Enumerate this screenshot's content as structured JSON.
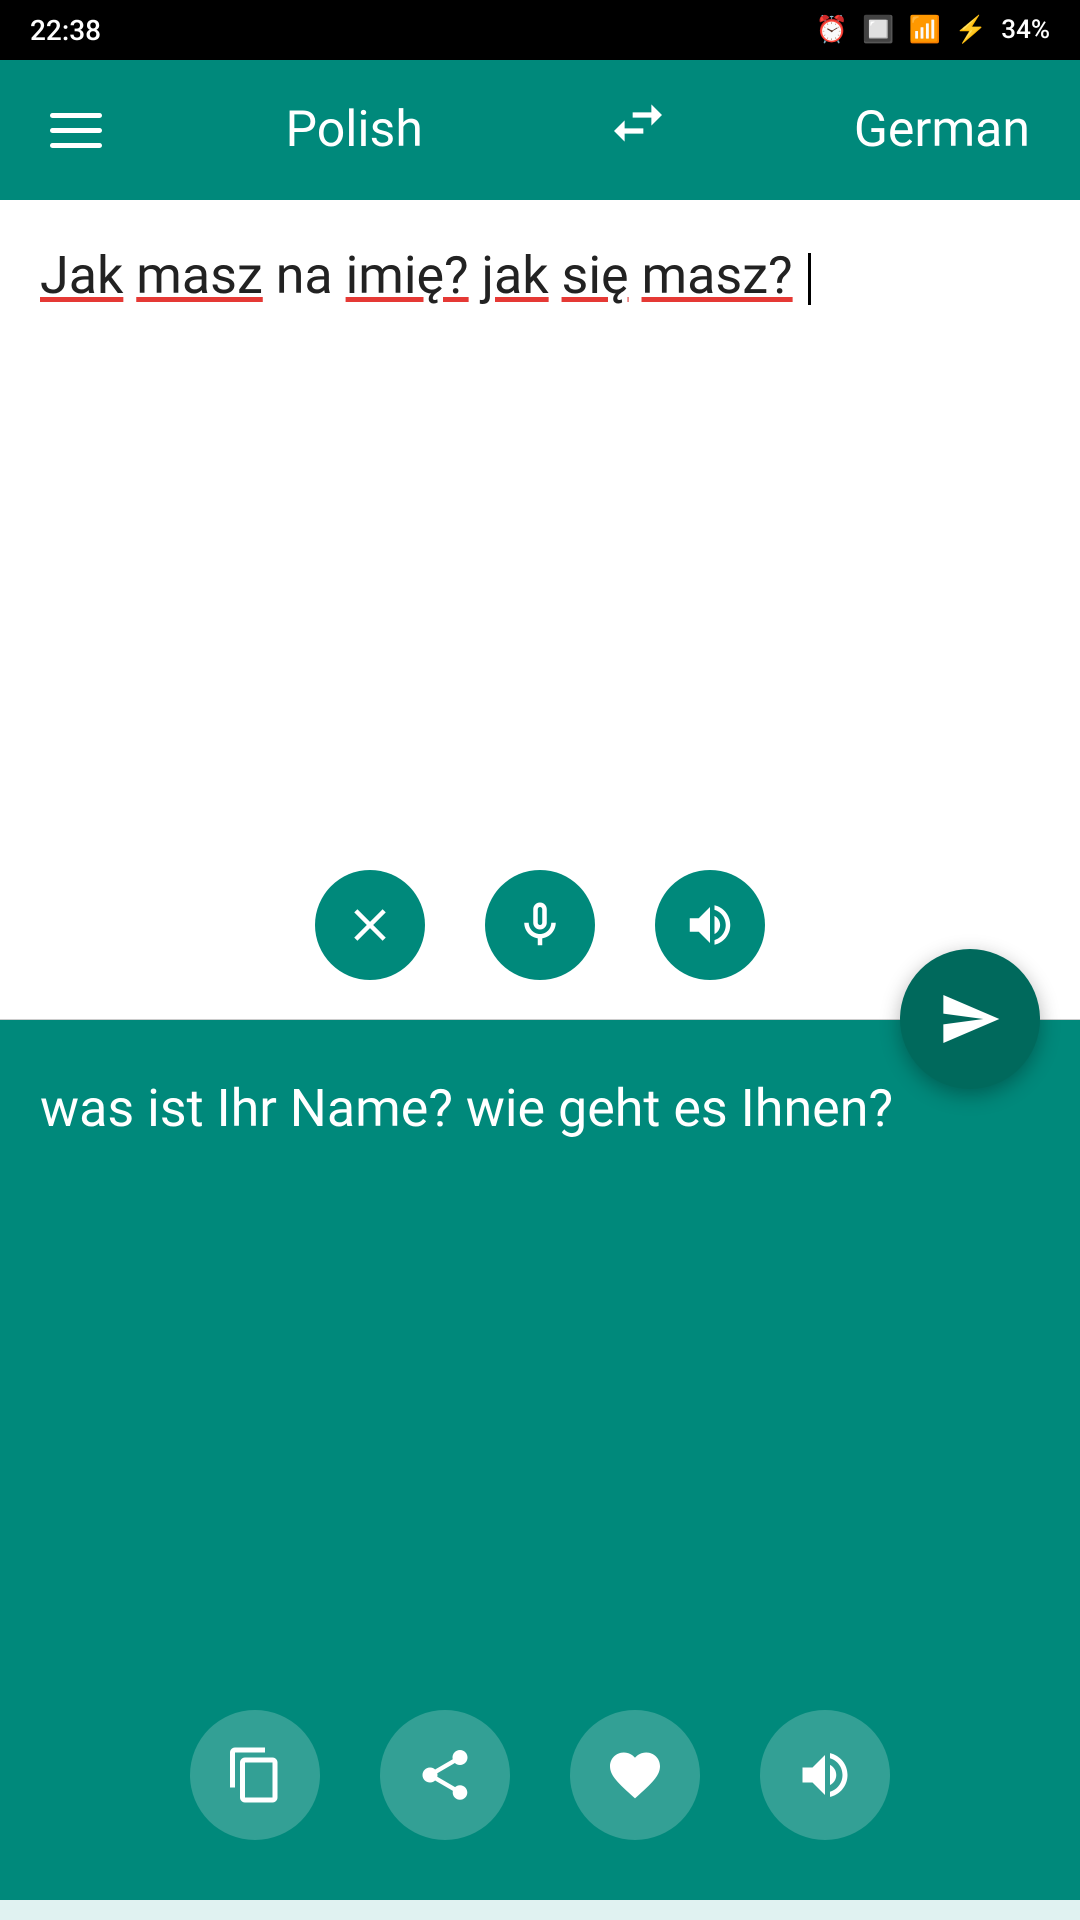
{
  "statusBar": {
    "time": "22:38",
    "battery": "34%"
  },
  "header": {
    "menuLabel": "menu",
    "sourceLang": "Polish",
    "targetLang": "German",
    "swapLabel": "swap languages"
  },
  "inputSection": {
    "inputText": "Jak masz na imię? jak się masz?",
    "clearLabel": "clear",
    "micLabel": "microphone",
    "speakLabel": "speak"
  },
  "translateButton": {
    "label": "translate"
  },
  "outputSection": {
    "outputText": "was ist Ihr Name? wie geht es Ihnen?",
    "copyLabel": "copy",
    "shareLabel": "share",
    "favoriteLabel": "favorite",
    "speakLabel": "speak translation"
  }
}
